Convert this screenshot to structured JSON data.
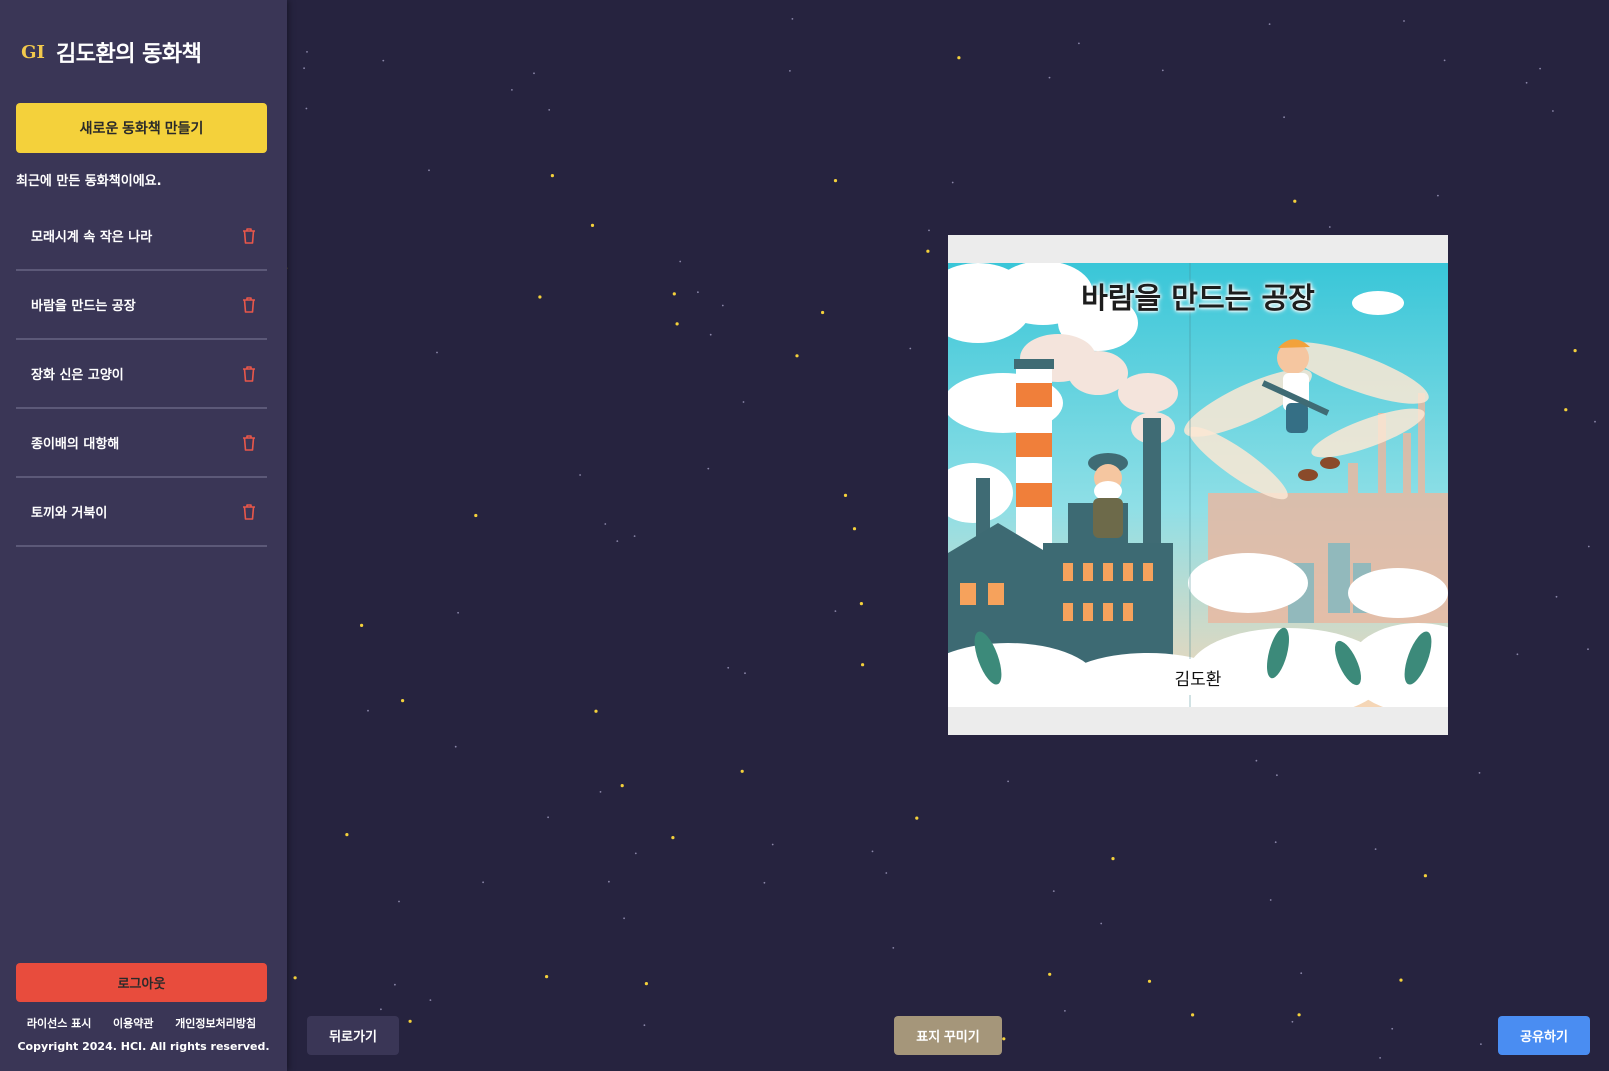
{
  "sidebar": {
    "brand_logo": "GI",
    "brand_title": "김도환의 동화책",
    "new_book_label": "새로운 동화책 만들기",
    "recent_label": "최근에 만든 동화책이에요.",
    "books": [
      {
        "title": "모래시계 속 작은 나라"
      },
      {
        "title": "바람을 만드는 공장"
      },
      {
        "title": "장화 신은 고양이"
      },
      {
        "title": "종이배의 대항해"
      },
      {
        "title": "토끼와 거북이"
      }
    ],
    "logout_label": "로그아웃",
    "footer_links": [
      "라이선스 표시",
      "이용약관",
      "개인정보처리방침"
    ],
    "copyright": "Copyright 2024. HCI. All rights reserved."
  },
  "cover": {
    "title": "바람을 만드는 공장",
    "author": "김도환"
  },
  "actions": {
    "back_label": "뒤로가기",
    "decorate_label": "표지 꾸미기",
    "share_label": "공유하기"
  },
  "colors": {
    "background": "#26233f",
    "sidebar": "#3a3656",
    "accent_yellow": "#f4d13b",
    "logout_red": "#e84c3d",
    "share_blue": "#4a8df2",
    "decorate_tan": "#a5967a",
    "trash_red": "#e8574a"
  },
  "icons": {
    "brand": "gi-logo-icon",
    "delete": "trash-icon"
  }
}
